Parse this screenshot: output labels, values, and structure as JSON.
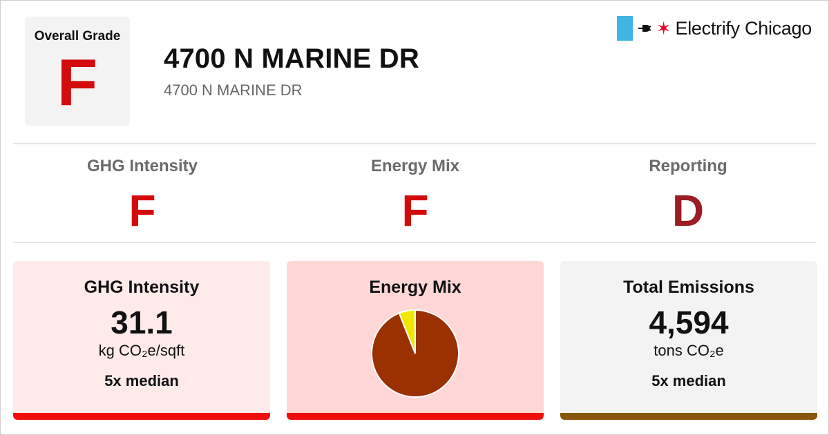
{
  "overall": {
    "label": "Overall Grade",
    "grade": "F"
  },
  "building": {
    "title": "4700 N MARINE DR",
    "subtitle": "4700 N MARINE DR"
  },
  "brand": {
    "name": "Electrify Chicago",
    "star": "✶",
    "stripe_color": "#41b6e6",
    "star_color": "#e4002b"
  },
  "subgrades": [
    {
      "label": "GHG Intensity",
      "grade": "F",
      "color": "#d40b0b"
    },
    {
      "label": "Energy Mix",
      "grade": "F",
      "color": "#d40b0b"
    },
    {
      "label": "Reporting",
      "grade": "D",
      "color": "#9b1c22"
    }
  ],
  "cards": {
    "ghg": {
      "title": "GHG Intensity",
      "value": "31.1",
      "unit": "kg CO₂e/sqft",
      "median": "5x median",
      "bar_color": "#f00f0f"
    },
    "energy": {
      "title": "Energy Mix",
      "bar_color": "#f00f0f"
    },
    "emissions": {
      "title": "Total Emissions",
      "value": "4,594",
      "unit": "tons CO₂e",
      "median": "5x median",
      "bar_color": "#8a560c"
    }
  },
  "chart_data": {
    "type": "pie",
    "slices": [
      {
        "share": 0.94,
        "color": "#9b3000"
      },
      {
        "share": 0.06,
        "color": "#f0e600"
      }
    ]
  }
}
